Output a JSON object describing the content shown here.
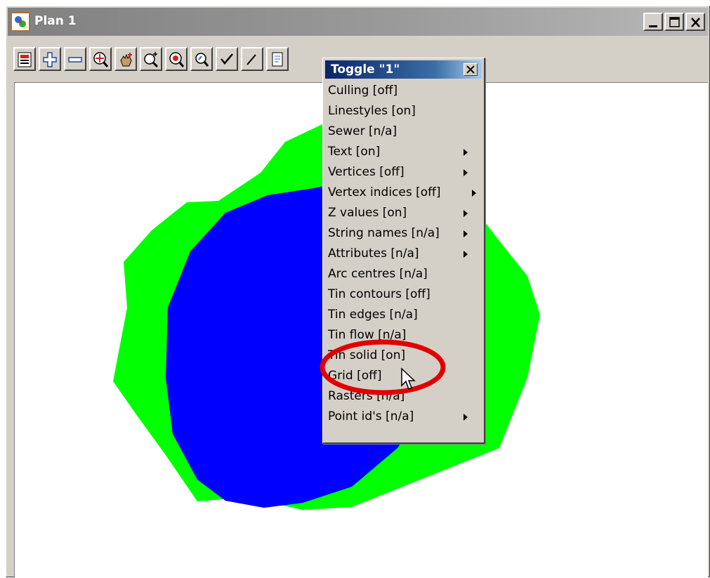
{
  "window": {
    "title": "Plan 1",
    "controls": [
      "minimize",
      "maximize",
      "close"
    ]
  },
  "toolbar": {
    "buttons": [
      {
        "name": "plot-icon"
      },
      {
        "name": "zoom-in-plus-icon"
      },
      {
        "name": "zoom-out-minus-icon"
      },
      {
        "name": "fit-view-icon"
      },
      {
        "name": "pan-hand-icon"
      },
      {
        "name": "zoom-window-icon"
      },
      {
        "name": "zoom-extents-icon"
      },
      {
        "name": "search-icon"
      },
      {
        "name": "toggle-check-icon"
      },
      {
        "name": "tool-icon"
      },
      {
        "name": "document-icon"
      }
    ]
  },
  "toggle_menu": {
    "title": "Toggle \"1\"",
    "items": [
      {
        "label": "Culling [off]",
        "submenu": false
      },
      {
        "label": "Linestyles [on]",
        "submenu": false
      },
      {
        "label": "Sewer [n/a]",
        "submenu": false
      },
      {
        "label": "Text [on]",
        "submenu": true
      },
      {
        "label": "Vertices [off]",
        "submenu": true
      },
      {
        "label": "Vertex indices [off]",
        "submenu": true
      },
      {
        "label": "Z values [on]",
        "submenu": true
      },
      {
        "label": "String names [n/a]",
        "submenu": true
      },
      {
        "label": "Attributes [n/a]",
        "submenu": true
      },
      {
        "label": "Arc centres [n/a]",
        "submenu": false
      },
      {
        "label": "Tin contours [off]",
        "submenu": false
      },
      {
        "label": "Tin edges [n/a]",
        "submenu": false
      },
      {
        "label": "Tin flow [n/a]",
        "submenu": false
      },
      {
        "label": "Tin solid [on]",
        "submenu": false,
        "highlighted": true
      },
      {
        "label": "Grid [off]",
        "submenu": false
      },
      {
        "label": "Rasters [n/a]",
        "submenu": false
      },
      {
        "label": "Point id's [n/a]",
        "submenu": true
      }
    ]
  },
  "colors": {
    "outer_region": "#00ff00",
    "inner_region": "#0000ff",
    "annotation_circle": "#e00000",
    "menu_title_bar": "#0a246a"
  }
}
